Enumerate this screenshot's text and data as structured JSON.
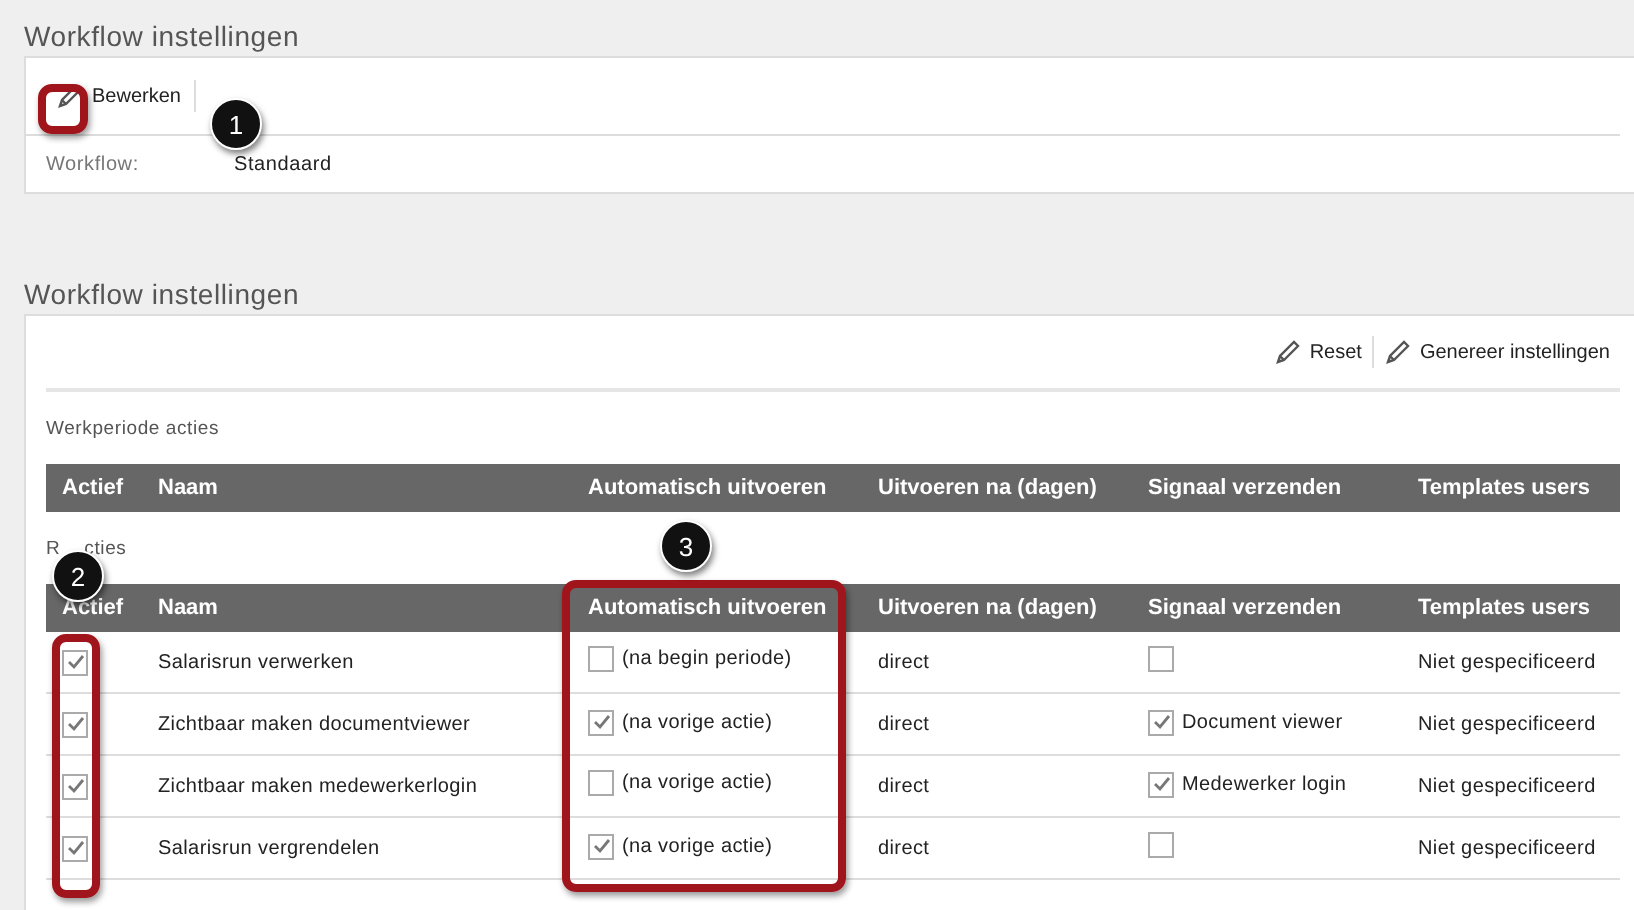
{
  "sections": [
    {
      "title": "Workflow instellingen"
    },
    {
      "title": "Workflow instellingen"
    }
  ],
  "edit_toolbar": {
    "button": "Bewerken"
  },
  "workflow_field": {
    "label": "Workflow:",
    "value": "Standaard"
  },
  "actions_toolbar": {
    "buttons": [
      "Reset",
      "Genereer instellingen"
    ]
  },
  "werkperiode": {
    "label": "Werkperiode acties",
    "columns": [
      "Actief",
      "Naam",
      "Automatisch uitvoeren",
      "Uitvoeren na (dagen)",
      "Signaal verzenden",
      "Templates users"
    ]
  },
  "run": {
    "label_start": "R",
    "label_end": "cties",
    "columns": [
      "Actief",
      "Naam",
      "Automatisch uitvoeren",
      "Uitvoeren na (dagen)",
      "Signaal verzenden",
      "Templates users"
    ],
    "rows": [
      {
        "actief": true,
        "naam": "Salarisrun verwerken",
        "auto_checked": false,
        "auto_text": "(na begin periode)",
        "uitvoeren": "direct",
        "signaal_checked": false,
        "templates": "Niet gespecificeerd"
      },
      {
        "actief": true,
        "naam": "Zichtbaar maken documentviewer",
        "auto_checked": true,
        "auto_text": "(na vorige actie)",
        "uitvoeren": "direct",
        "signaal_checked": true,
        "signaal_text": "Document viewer",
        "templates": "Niet gespecificeerd"
      },
      {
        "actief": true,
        "naam": "Zichtbaar maken medewerkerlogin",
        "auto_checked": false,
        "auto_text": "(na vorige actie)",
        "uitvoeren": "direct",
        "signaal_checked": true,
        "signaal_text": "Medewerker login",
        "templates": "Niet gespecificeerd"
      },
      {
        "actief": true,
        "naam": "Salarisrun vergrendelen",
        "auto_checked": true,
        "auto_text": "(na vorige actie)",
        "uitvoeren": "direct",
        "signaal_checked": false,
        "templates": "Niet gespecificeerd"
      }
    ]
  },
  "callouts": [
    {
      "label": "1"
    },
    {
      "label": "2"
    },
    {
      "label": "3"
    }
  ]
}
